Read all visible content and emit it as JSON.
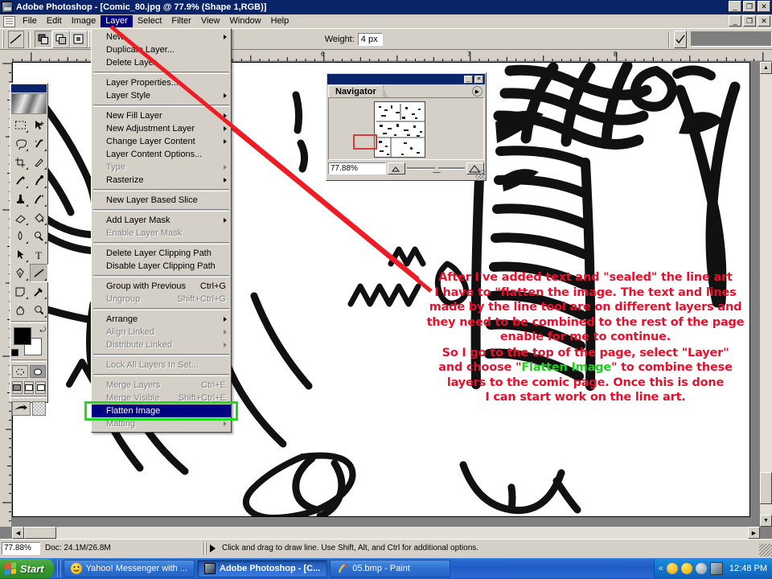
{
  "window": {
    "title": "Adobe Photoshop - [Comic_80.jpg @ 77.9% (Shape 1,RGB)]",
    "app_icon": "photoshop-icon",
    "minimize": "_",
    "maximize": "❐",
    "close": "✕"
  },
  "menubar": {
    "items": [
      {
        "label": "File"
      },
      {
        "label": "Edit"
      },
      {
        "label": "Image"
      },
      {
        "label": "Layer"
      },
      {
        "label": "Select"
      },
      {
        "label": "Filter"
      },
      {
        "label": "View"
      },
      {
        "label": "Window"
      },
      {
        "label": "Help"
      }
    ],
    "active": "Layer"
  },
  "options_bar": {
    "tool": "line-tool",
    "shape_modes": [
      "shape-layers",
      "paths",
      "fill-pixels",
      "custom-shape"
    ],
    "weight_label": "Weight:",
    "weight_value": "4 px",
    "confirm_icon": "check-icon",
    "color_value": "#7f7f7f"
  },
  "toolbox": {
    "tools": [
      "marquee-tool",
      "move-tool",
      "lasso-tool",
      "magic-wand-tool",
      "crop-tool",
      "slice-tool",
      "healing-brush-tool",
      "brush-tool",
      "clone-stamp-tool",
      "history-brush-tool",
      "eraser-tool",
      "paint-bucket-tool",
      "blur-tool",
      "dodge-tool",
      "path-selection-tool",
      "type-tool",
      "pen-tool",
      "line-tool",
      "notes-tool",
      "eyedropper-tool",
      "hand-tool",
      "zoom-tool"
    ],
    "selected_tool": "line-tool",
    "foreground_color": "#000000",
    "background_color": "#ffffff",
    "mode_buttons": [
      "standard-mask-mode",
      "quick-mask-mode"
    ],
    "screen_modes": [
      "standard-screen-mode",
      "full-screen-menubar-mode",
      "full-screen-mode"
    ],
    "jump_to_imageready": "jump-to-imageready-icon"
  },
  "navigator": {
    "tab_label": "Navigator",
    "minimize": "_",
    "close": "✕",
    "palette_menu_icon": "palette-menu-icon",
    "zoom_value": "77.88%",
    "zoom_out_icon": "small-mountains-icon",
    "zoom_in_icon": "large-mountains-icon",
    "view_box_color": "#d93b3b"
  },
  "layer_menu": {
    "items": [
      {
        "label": "New",
        "submenu": true,
        "disabled": false
      },
      {
        "label": "Duplicate Layer...",
        "submenu": false,
        "disabled": false
      },
      {
        "label": "Delete Layer",
        "submenu": false,
        "disabled": false
      },
      {
        "separator": true
      },
      {
        "label": "Layer Properties...",
        "submenu": false,
        "disabled": false
      },
      {
        "label": "Layer Style",
        "submenu": true,
        "disabled": false
      },
      {
        "separator": true
      },
      {
        "label": "New Fill Layer",
        "submenu": true,
        "disabled": false
      },
      {
        "label": "New Adjustment Layer",
        "submenu": true,
        "disabled": false
      },
      {
        "label": "Change Layer Content",
        "submenu": true,
        "disabled": false
      },
      {
        "label": "Layer Content Options...",
        "submenu": false,
        "disabled": false
      },
      {
        "label": "Type",
        "submenu": true,
        "disabled": true
      },
      {
        "label": "Rasterize",
        "submenu": true,
        "disabled": false
      },
      {
        "separator": true
      },
      {
        "label": "New Layer Based Slice",
        "submenu": false,
        "disabled": false
      },
      {
        "separator": true
      },
      {
        "label": "Add Layer Mask",
        "submenu": true,
        "disabled": false
      },
      {
        "label": "Enable Layer Mask",
        "submenu": false,
        "disabled": true
      },
      {
        "separator": true
      },
      {
        "label": "Delete Layer Clipping Path",
        "submenu": false,
        "disabled": false
      },
      {
        "label": "Disable Layer Clipping Path",
        "submenu": false,
        "disabled": false
      },
      {
        "separator": true
      },
      {
        "label": "Group with Previous",
        "accel": "Ctrl+G",
        "submenu": false,
        "disabled": false
      },
      {
        "label": "Ungroup",
        "accel": "Shift+Ctrl+G",
        "submenu": false,
        "disabled": true
      },
      {
        "separator": true
      },
      {
        "label": "Arrange",
        "submenu": true,
        "disabled": false
      },
      {
        "label": "Align Linked",
        "submenu": true,
        "disabled": true
      },
      {
        "label": "Distribute Linked",
        "submenu": true,
        "disabled": true
      },
      {
        "separator": true
      },
      {
        "label": "Lock All Layers In Set...",
        "submenu": false,
        "disabled": true
      },
      {
        "separator": true
      },
      {
        "label": "Merge Layers",
        "accel": "Ctrl+E",
        "submenu": false,
        "disabled": true
      },
      {
        "label": "Merge Visible",
        "accel": "Shift+Ctrl+E",
        "submenu": false,
        "disabled": true
      },
      {
        "label": "Flatten Image",
        "submenu": false,
        "disabled": false,
        "selected": true
      },
      {
        "label": "Matting",
        "submenu": true,
        "disabled": true
      }
    ],
    "highlight_color": "#22d822"
  },
  "annotation": {
    "paragraph1_lines": [
      "After I've added text and \"sealed\" the line art",
      "I have to \"flatten the image. The text and lines",
      "made by the line tool are on different layers and",
      "they need to be combined to the rest of the page",
      "enable for me to continue."
    ],
    "paragraph2_line1": "So I go to the top of the page, select \"Layer\"",
    "paragraph2_line2_pre": "and choose \"",
    "paragraph2_highlight": "Flatten Image",
    "paragraph2_line2_post": "\" to combine these",
    "paragraph2_line3": "layers to the comic page. Once this is done",
    "paragraph2_line4": "I can start work on the line art.",
    "text_color": "#e8112d",
    "highlight_color": "#19d219",
    "arrow_color": "#ee1c25"
  },
  "ruler": {
    "horizontal_labels": [
      "6",
      "7",
      "8"
    ],
    "vertical_labels": []
  },
  "statusbar": {
    "zoom": "77.88%",
    "doc": "Doc: 24.1M/26.8M",
    "hint": "Click and drag to draw line. Use Shift, Alt, and Ctrl for additional options."
  },
  "taskbar": {
    "start_label": "Start",
    "buttons": [
      {
        "label": "Yahoo! Messenger with ...",
        "icon": "yahoo-messenger-icon",
        "active": false
      },
      {
        "label": "Adobe Photoshop - [C...",
        "icon": "photoshop-icon",
        "active": true
      },
      {
        "label": "05.bmp - Paint",
        "icon": "paint-icon",
        "active": false
      }
    ],
    "tray": {
      "expand_icon": "chevron-left-icon",
      "icons": [
        "security-shield-icon",
        "yahoo-messenger-tray-icon",
        "media-icon",
        "photoshop-tray-icon"
      ],
      "clock": "12:48 PM"
    }
  }
}
